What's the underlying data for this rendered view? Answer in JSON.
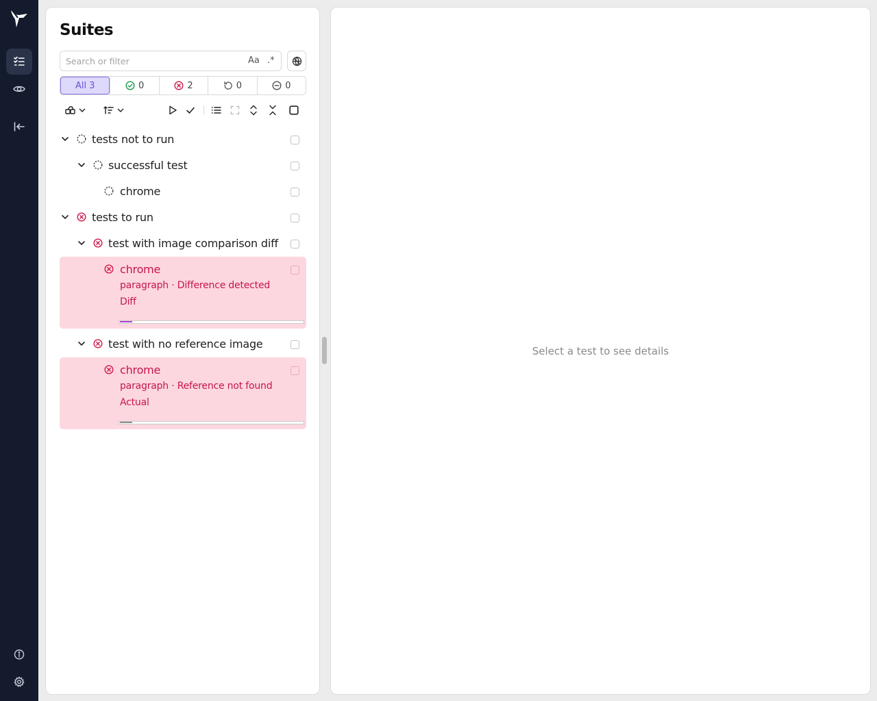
{
  "rail": {
    "logo_icon": "testplane-logo",
    "items": [
      {
        "name": "suites-list-icon",
        "active": true
      },
      {
        "name": "eye-icon",
        "active": false
      },
      {
        "name": "collapse-sidebar-icon",
        "active": false
      }
    ],
    "bottom": [
      {
        "name": "info-icon"
      },
      {
        "name": "settings-gear-icon"
      }
    ]
  },
  "suites_panel": {
    "title": "Suites",
    "search": {
      "placeholder": "Search or filter",
      "value": "",
      "match_case_label": "Aa",
      "regex_label": ".*"
    },
    "filters": [
      {
        "label": "All 3",
        "icon": "",
        "active": true
      },
      {
        "label": "0",
        "icon": "check-circle-icon",
        "color": "#1a9a4f"
      },
      {
        "label": "2",
        "icon": "x-circle-icon",
        "color": "#d11a4b"
      },
      {
        "label": "0",
        "icon": "retry-icon",
        "color": "#555555"
      },
      {
        "label": "0",
        "icon": "minus-circle-icon",
        "color": "#555555"
      }
    ],
    "tree": {
      "suite1": {
        "label": "tests not to run",
        "status": "idle"
      },
      "test1": {
        "label": "successful test",
        "status": "idle"
      },
      "browser1": {
        "label": "chrome",
        "status": "idle"
      },
      "suite2": {
        "label": "tests to run",
        "status": "failed"
      },
      "test2": {
        "label": "test with image comparison diff",
        "status": "failed"
      },
      "browser2": {
        "label": "chrome",
        "status": "failed",
        "line1": "paragraph · Difference detected",
        "line2": "Diff"
      },
      "test3": {
        "label": "test with no reference image",
        "status": "failed"
      },
      "browser3": {
        "label": "chrome",
        "status": "failed",
        "line1": "paragraph · Reference not found",
        "line2": "Actual"
      }
    }
  },
  "details_panel": {
    "empty_text": "Select a test to see details"
  },
  "colors": {
    "rail": "#141b2d",
    "fail": "#c5164b",
    "fail_bg": "#fdd7df",
    "accent": "#6b4fd8"
  }
}
